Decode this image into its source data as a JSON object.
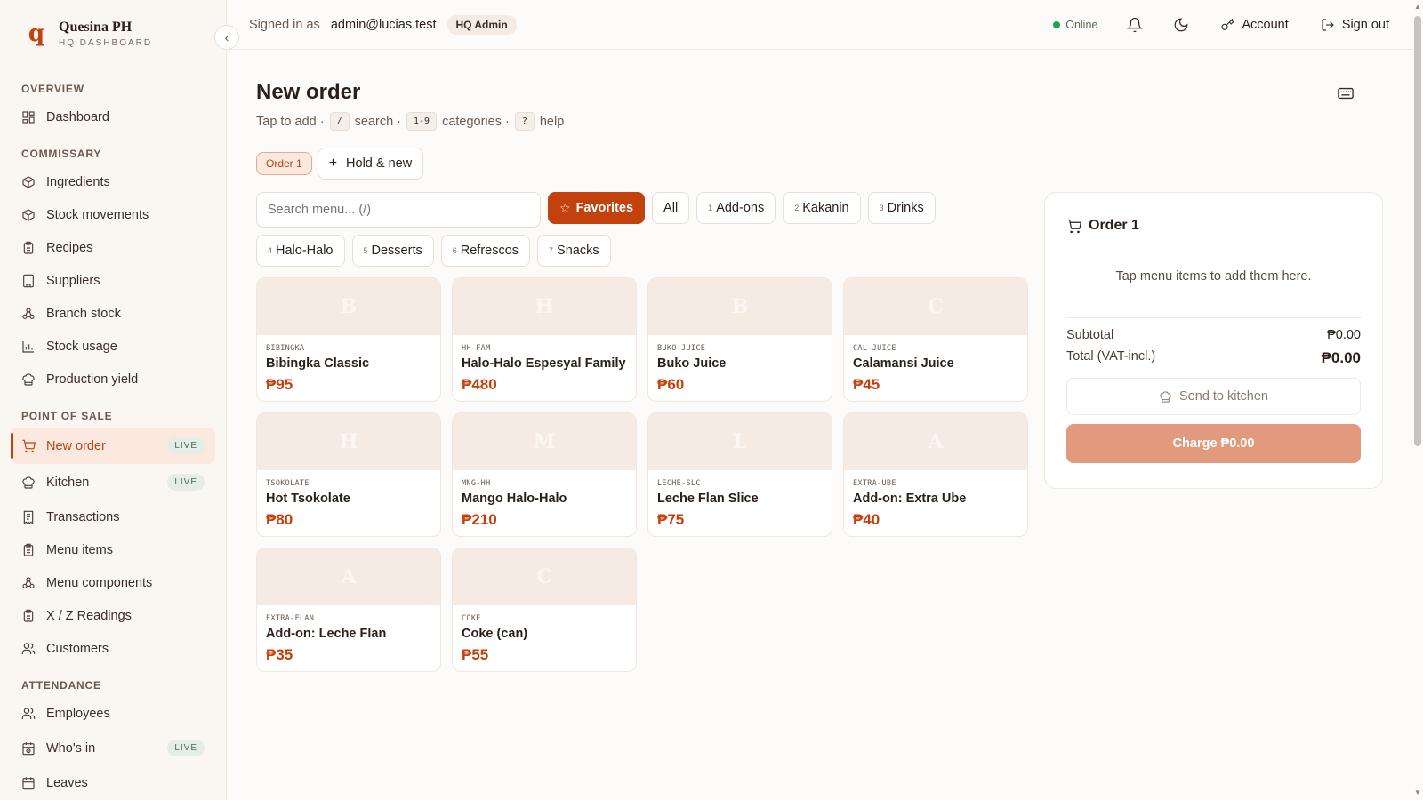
{
  "brand": {
    "logo": "q",
    "name": "Quesina PH",
    "subtitle": "HQ DASHBOARD"
  },
  "topbar": {
    "signed_in_label": "Signed in as",
    "email": "admin@lucias.test",
    "role": "HQ Admin",
    "status": "Online",
    "account_label": "Account",
    "sign_out_label": "Sign out"
  },
  "sidebar": {
    "sections": [
      {
        "title": "OVERVIEW",
        "items": [
          {
            "label": "Dashboard",
            "icon": "dashboard-icon"
          }
        ]
      },
      {
        "title": "COMMISSARY",
        "items": [
          {
            "label": "Ingredients",
            "icon": "box-icon"
          },
          {
            "label": "Stock movements",
            "icon": "box-icon"
          },
          {
            "label": "Recipes",
            "icon": "clipboard-icon"
          },
          {
            "label": "Suppliers",
            "icon": "building-icon"
          },
          {
            "label": "Branch stock",
            "icon": "branch-icon"
          },
          {
            "label": "Stock usage",
            "icon": "chart-icon"
          },
          {
            "label": "Production yield",
            "icon": "chef-hat-icon"
          }
        ]
      },
      {
        "title": "POINT OF SALE",
        "items": [
          {
            "label": "New order",
            "icon": "cart-icon",
            "badge": "LIVE",
            "active": true
          },
          {
            "label": "Kitchen",
            "icon": "chef-hat-icon",
            "badge": "LIVE"
          },
          {
            "label": "Transactions",
            "icon": "receipt-icon"
          },
          {
            "label": "Menu items",
            "icon": "clipboard-icon"
          },
          {
            "label": "Menu components",
            "icon": "branch-icon"
          },
          {
            "label": "X / Z Readings",
            "icon": "clipboard-icon"
          },
          {
            "label": "Customers",
            "icon": "users-icon"
          }
        ]
      },
      {
        "title": "ATTENDANCE",
        "items": [
          {
            "label": "Employees",
            "icon": "users-icon"
          },
          {
            "label": "Who's in",
            "icon": "clock-icon",
            "badge": "LIVE"
          },
          {
            "label": "Leaves",
            "icon": "calendar-icon"
          }
        ]
      }
    ]
  },
  "page": {
    "title": "New order",
    "hint": {
      "tap": "Tap to add ·",
      "k1": "/",
      "search": "search ·",
      "k2": "1-9",
      "categories": "categories ·",
      "k3": "?",
      "help": "help"
    }
  },
  "orders": {
    "current_tab": "Order 1",
    "hold_new_label": "Hold & new"
  },
  "search": {
    "placeholder": "Search menu... (/)"
  },
  "categories": {
    "favorites": "Favorites",
    "all": "All",
    "list": [
      {
        "num": "1",
        "label": "Add-ons"
      },
      {
        "num": "2",
        "label": "Kakanin"
      },
      {
        "num": "3",
        "label": "Drinks"
      },
      {
        "num": "4",
        "label": "Halo-Halo"
      },
      {
        "num": "5",
        "label": "Desserts"
      },
      {
        "num": "6",
        "label": "Refrescos"
      },
      {
        "num": "7",
        "label": "Snacks"
      }
    ]
  },
  "menu_items": [
    {
      "initial": "B",
      "code": "BIBINGKA",
      "name": "Bibingka Classic",
      "price": "₱95"
    },
    {
      "initial": "H",
      "code": "HH-FAM",
      "name": "Halo-Halo Espesyal Family",
      "price": "₱480"
    },
    {
      "initial": "B",
      "code": "BUKO-JUICE",
      "name": "Buko Juice",
      "price": "₱60"
    },
    {
      "initial": "C",
      "code": "CAL-JUICE",
      "name": "Calamansi Juice",
      "price": "₱45"
    },
    {
      "initial": "H",
      "code": "TSOKOLATE",
      "name": "Hot Tsokolate",
      "price": "₱80"
    },
    {
      "initial": "M",
      "code": "MNG-HH",
      "name": "Mango Halo-Halo",
      "price": "₱210"
    },
    {
      "initial": "L",
      "code": "LECHE-SLC",
      "name": "Leche Flan Slice",
      "price": "₱75"
    },
    {
      "initial": "A",
      "code": "EXTRA-UBE",
      "name": "Add-on: Extra Ube",
      "price": "₱40"
    },
    {
      "initial": "A",
      "code": "EXTRA-FLAN",
      "name": "Add-on: Leche Flan",
      "price": "₱35"
    },
    {
      "initial": "C",
      "code": "COKE",
      "name": "Coke (can)",
      "price": "₱55"
    }
  ],
  "order_panel": {
    "title": "Order 1",
    "empty_message": "Tap menu items to add them here.",
    "subtotal_label": "Subtotal",
    "subtotal_value": "₱0.00",
    "total_label": "Total (VAT-incl.)",
    "total_value": "₱0.00",
    "send_label": "Send to kitchen",
    "charge_label": "Charge ₱0.00"
  },
  "colors": {
    "accent": "#c2410c",
    "charge_disabled": "#e29a7e",
    "online": "#22a05a"
  }
}
